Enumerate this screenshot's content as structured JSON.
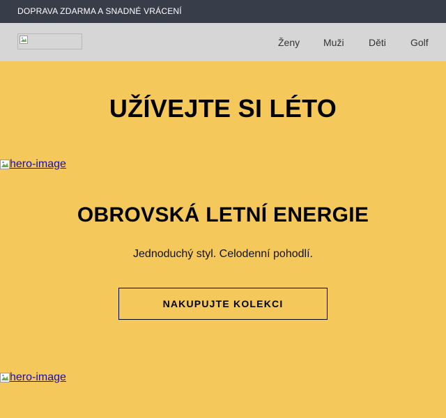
{
  "topbar": {
    "announcement": "DOPRAVA ZDARMA A SNADNÉ VRÁCENÍ"
  },
  "header": {
    "logo_alt": "",
    "nav": [
      {
        "label": "Ženy"
      },
      {
        "label": "Muži"
      },
      {
        "label": "Děti"
      },
      {
        "label": "Golf"
      }
    ]
  },
  "main": {
    "headline": "UŽÍVEJTE SI LÉTO",
    "hero_images": [
      {
        "alt": "hero-image"
      },
      {
        "alt": "hero-image"
      }
    ],
    "section_title": "OBROVSKÁ LETNÍ ENERGIE",
    "tagline": "Jednoduchý styl. Celodenní pohodlí.",
    "cta_label": "NAKUPUJTE KOLEKCI"
  },
  "colors": {
    "topbar_bg": "#383d4a",
    "navbar_bg": "#d6d6d6",
    "page_bg": "#f5c85c",
    "link": "#1a0dab"
  },
  "icons": {
    "broken_image": "broken-image-icon"
  }
}
